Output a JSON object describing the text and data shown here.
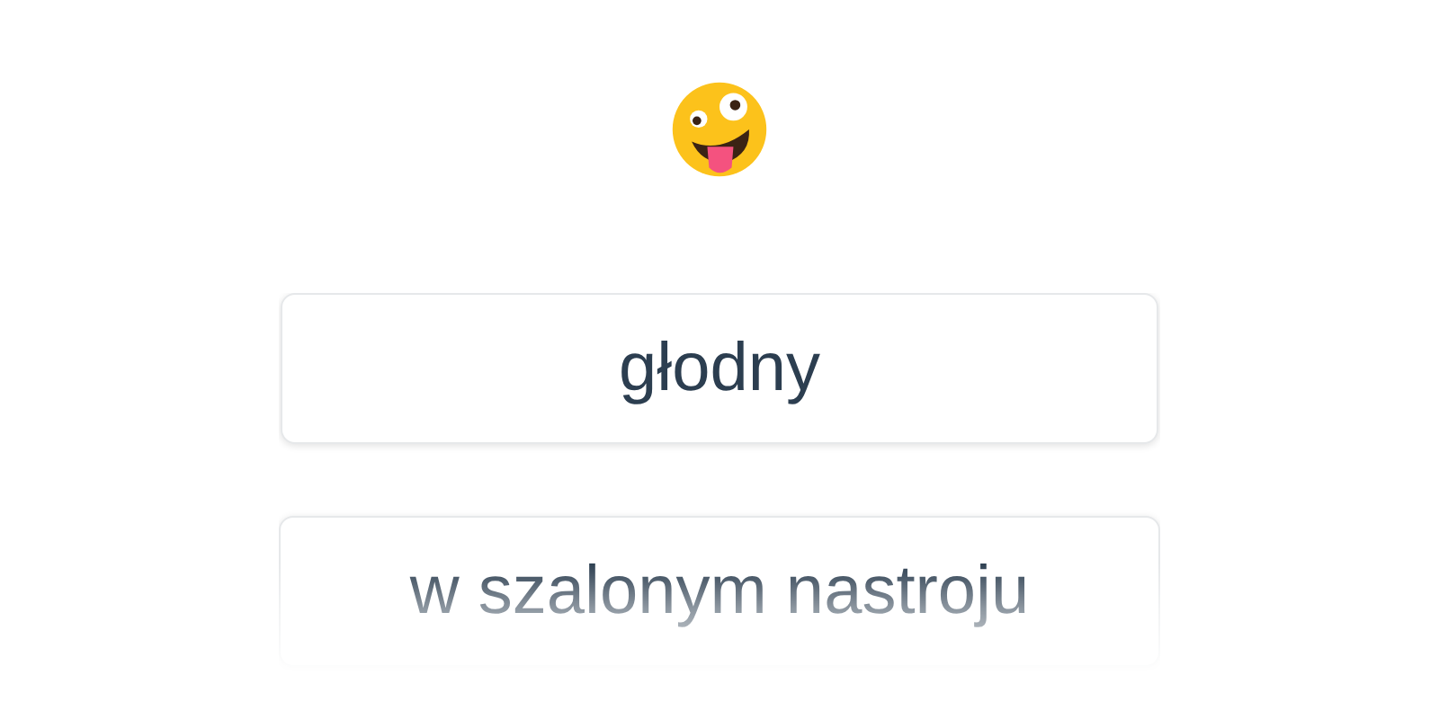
{
  "options": [
    {
      "label": "głodny"
    },
    {
      "label": "w szalonym nastroju"
    }
  ]
}
